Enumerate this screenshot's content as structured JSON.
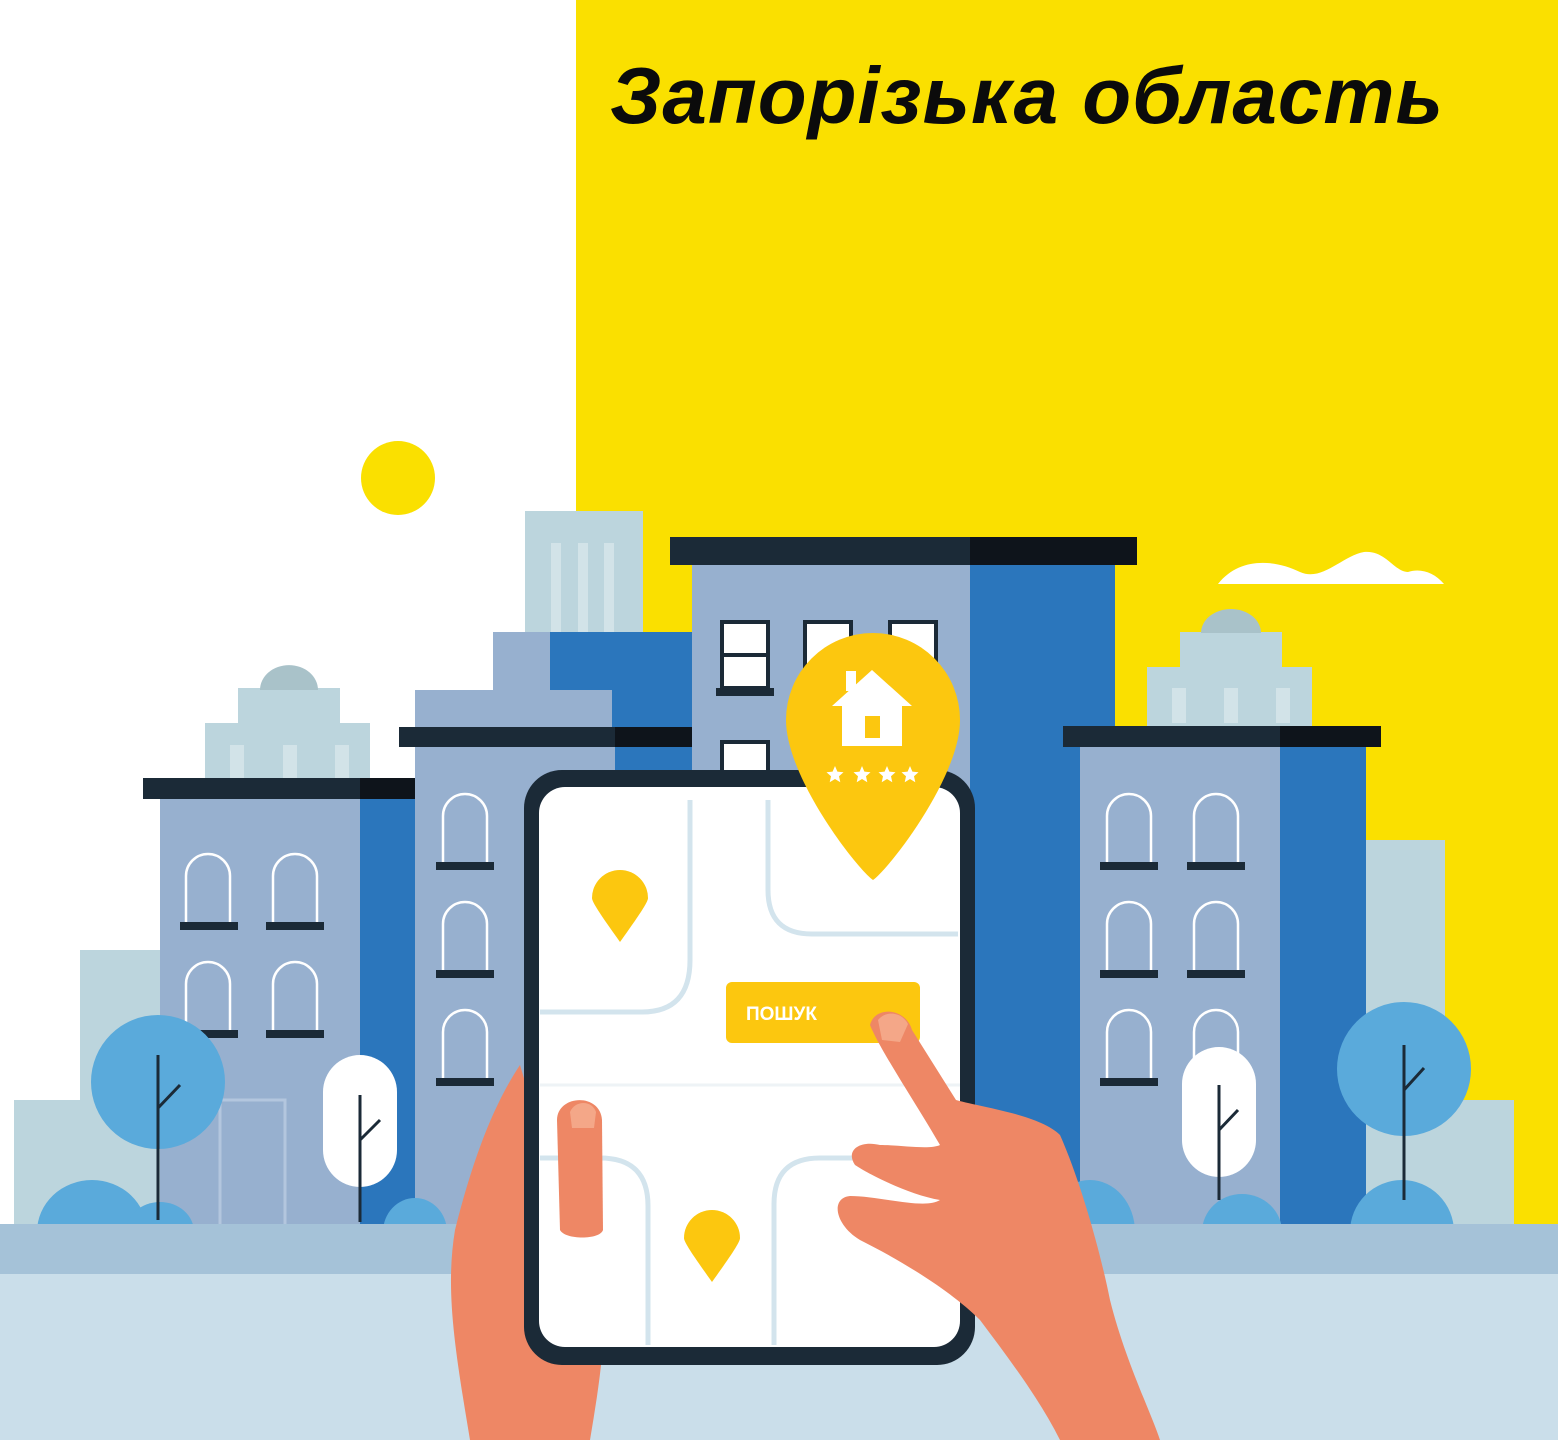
{
  "title": "Запорізька область",
  "search_button_label": "ПОШУК",
  "hotel_rating_stars": 4,
  "icons": {
    "house": "house-icon",
    "star": "star-icon",
    "pin": "map-pin-icon",
    "sun": "sun-icon",
    "cloud": "cloud-icon"
  },
  "colors": {
    "brand_yellow": "#fae000",
    "pin_yellow": "#fcc70f",
    "building_light": "#97b0cf",
    "building_blue": "#2b76bc",
    "building_pale": "#bcd5dd",
    "roof_dark": "#1b2a37",
    "tree_blue": "#5aaadb",
    "hand": "#ee8765",
    "ground": "#cadeea"
  }
}
